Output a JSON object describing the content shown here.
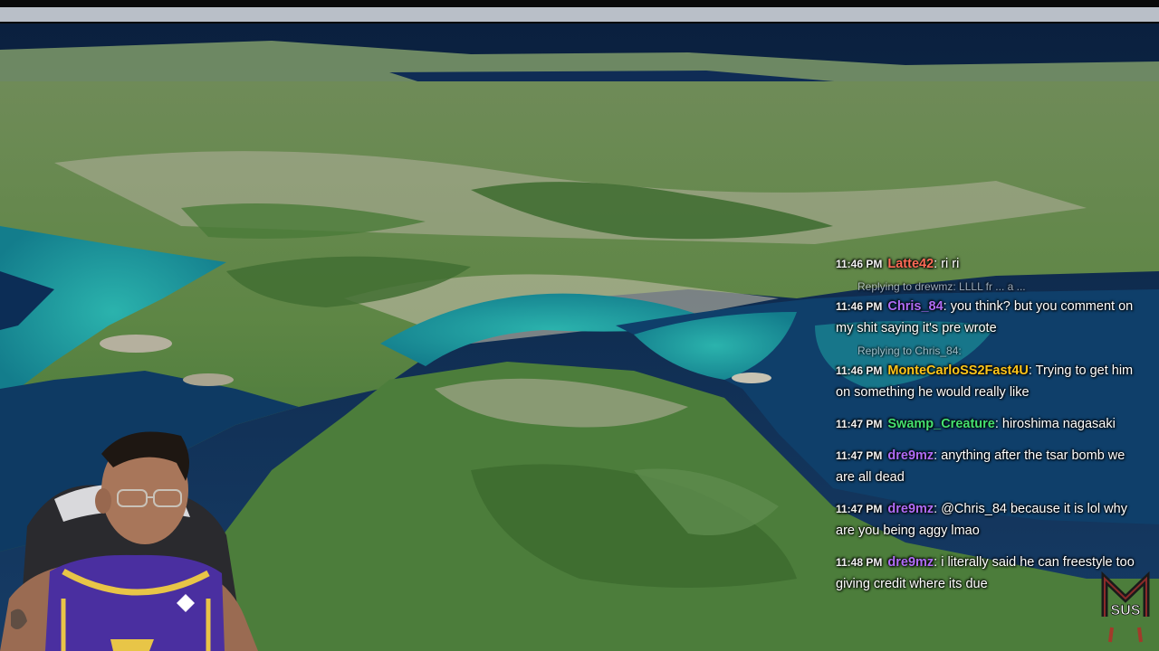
{
  "scene": {
    "description_free": true,
    "colors": {
      "ocean_deep": "#0c2d56",
      "ocean_shallow": "#1fa7a6",
      "land_green": "#4f7f3a",
      "land_urban": "#b8b3a4"
    }
  },
  "chat": {
    "messages": [
      {
        "time": "11:46 PM",
        "user": "Latte42",
        "user_color": "#ff6b57",
        "text": ": ri ri",
        "reply": ""
      },
      {
        "time": "11:46 PM",
        "user": "Chris_84",
        "user_color": "#b06cf7",
        "text": ": you think? but you comment on my shit saying it's pre wrote",
        "reply": "Replying to drewmz: LLLL fr ... a ..."
      },
      {
        "time": "11:46 PM",
        "user": "MonteCarloSS2Fast4U",
        "user_color": "#ffc61a",
        "text": ": Trying to get him on something he would really like",
        "reply": "Replying to Chris_84:"
      },
      {
        "time": "11:47 PM",
        "user": "Swamp_Creature",
        "user_color": "#45e070",
        "text": ": hiroshima nagasaki",
        "reply": ""
      },
      {
        "time": "11:47 PM",
        "user": "dre9mz",
        "user_color": "#b06cf7",
        "text": ": anything after the tsar bomb we are all dead",
        "reply": ""
      },
      {
        "time": "11:47 PM",
        "user": "dre9mz",
        "user_color": "#b06cf7",
        "text": ": @Chris_84 because it is lol why are you being aggy lmao",
        "reply": ""
      },
      {
        "time": "11:48 PM",
        "user": "dre9mz",
        "user_color": "#b06cf7",
        "text": ": i literally said he can freestyle too giving credit where its due",
        "reply": ""
      }
    ]
  },
  "overlay": {
    "badge_text": "SUS",
    "badge_icon": "monogram-logo-icon"
  }
}
